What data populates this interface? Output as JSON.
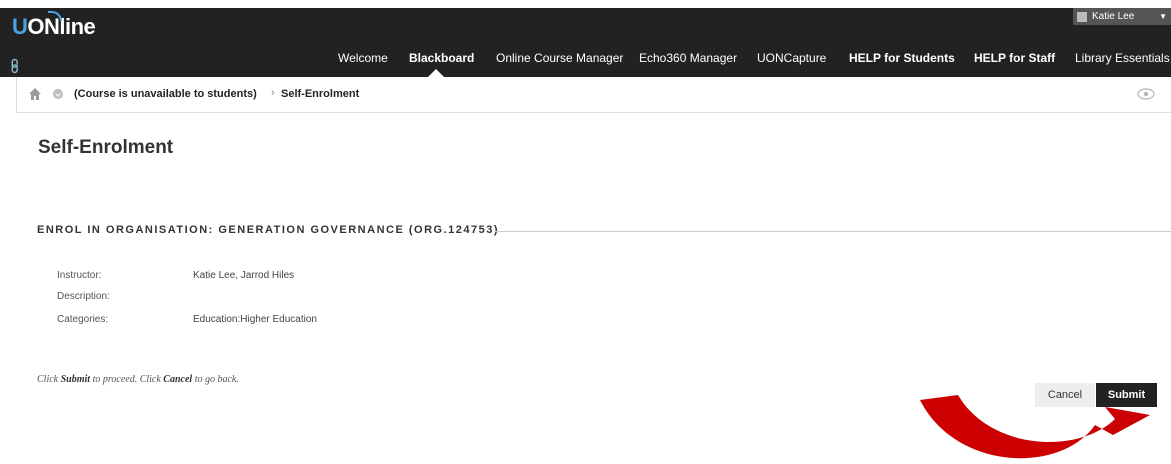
{
  "header": {
    "logo_prefix": "U",
    "logo_rest": "ONline",
    "user_name": "Katie Lee",
    "nav": [
      {
        "label": "Welcome"
      },
      {
        "label": "Blackboard"
      },
      {
        "label": "Online Course Manager"
      },
      {
        "label": "Echo360 Manager"
      },
      {
        "label": "UONCapture"
      },
      {
        "label": "HELP for Students"
      },
      {
        "label": "HELP for Staff"
      },
      {
        "label": "Library Essentials"
      }
    ],
    "active_nav": "Blackboard"
  },
  "breadcrumb": {
    "items": [
      "(Course is unavailable to students)",
      "Self-Enrolment"
    ],
    "separator": "›"
  },
  "page": {
    "title": "Self-Enrolment",
    "section_heading": "ENROL IN ORGANISATION: GENERATION GOVERNANCE (ORG.124753)",
    "fields": [
      {
        "label": "Instructor:",
        "value": "Katie Lee, Jarrod Hiles"
      },
      {
        "label": "Description:",
        "value": ""
      },
      {
        "label": "Categories:",
        "value": "Education:Higher Education"
      }
    ],
    "instructions": {
      "t1": "Click ",
      "b1": "Submit",
      "t2": " to proceed. Click ",
      "b2": "Cancel",
      "t3": " to go back."
    },
    "cancel_label": "Cancel",
    "submit_label": "Submit"
  },
  "colors": {
    "header_bg": "#222222",
    "logo_accent": "#4aa3df",
    "arrow": "#cc0000",
    "submit_bg": "#222222"
  },
  "icons": [
    "link-icon",
    "user-avatar-icon",
    "caret-down-icon",
    "home-icon",
    "menu-circle-icon",
    "eye-icon",
    "red-arrow-annotation"
  ]
}
